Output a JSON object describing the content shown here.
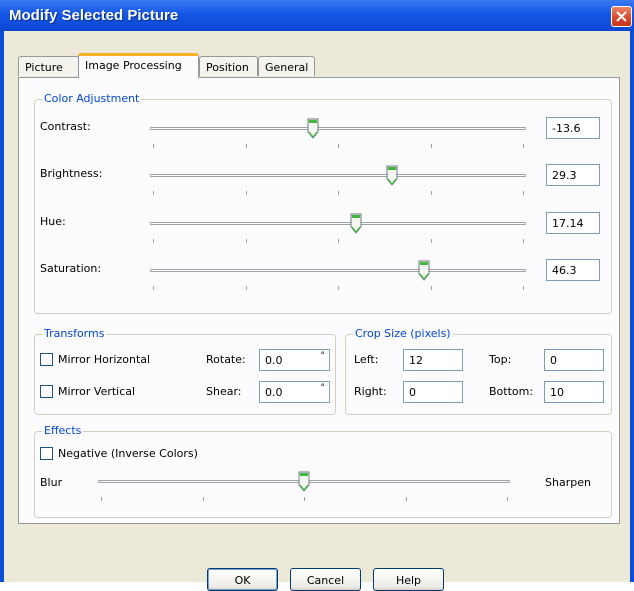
{
  "window": {
    "title": "Modify Selected Picture"
  },
  "tabs": [
    {
      "label": "Picture",
      "active": false
    },
    {
      "label": "Image Processing",
      "active": true
    },
    {
      "label": "Position",
      "active": false
    },
    {
      "label": "General",
      "active": false
    }
  ],
  "color_adjustment": {
    "title": "Color Adjustment",
    "contrast": {
      "label": "Contrast:",
      "value": "-13.6"
    },
    "brightness": {
      "label": "Brightness:",
      "value": "29.3"
    },
    "hue": {
      "label": "Hue:",
      "value": "17.14"
    },
    "saturation": {
      "label": "Saturation:",
      "value": "46.3"
    }
  },
  "transforms": {
    "title": "Transforms",
    "mirror_horizontal": {
      "label": "Mirror Horizontal",
      "checked": false
    },
    "mirror_vertical": {
      "label": "Mirror Vertical",
      "checked": false
    },
    "rotate": {
      "label": "Rotate:",
      "value": "0.0",
      "unit": "°"
    },
    "shear": {
      "label": "Shear:",
      "value": "0.0",
      "unit": "°"
    }
  },
  "crop": {
    "title": "Crop Size (pixels)",
    "left": {
      "label": "Left:",
      "value": "12"
    },
    "top": {
      "label": "Top:",
      "value": "0"
    },
    "right": {
      "label": "Right:",
      "value": "0"
    },
    "bottom": {
      "label": "Bottom:",
      "value": "10"
    }
  },
  "effects": {
    "title": "Effects",
    "negative": {
      "label": "Negative (Inverse Colors)",
      "checked": false
    },
    "blur_label": "Blur",
    "sharpen_label": "Sharpen"
  },
  "buttons": {
    "ok": "OK",
    "cancel": "Cancel",
    "help": "Help"
  },
  "colors": {
    "titlebar": "#0a4fd6",
    "group_title": "#0046d5",
    "thumb_accent": "#3fb83f",
    "active_tab": "#f9b227"
  },
  "icons": {
    "close": "close-icon",
    "slider_thumb": "slider-thumb-icon"
  }
}
